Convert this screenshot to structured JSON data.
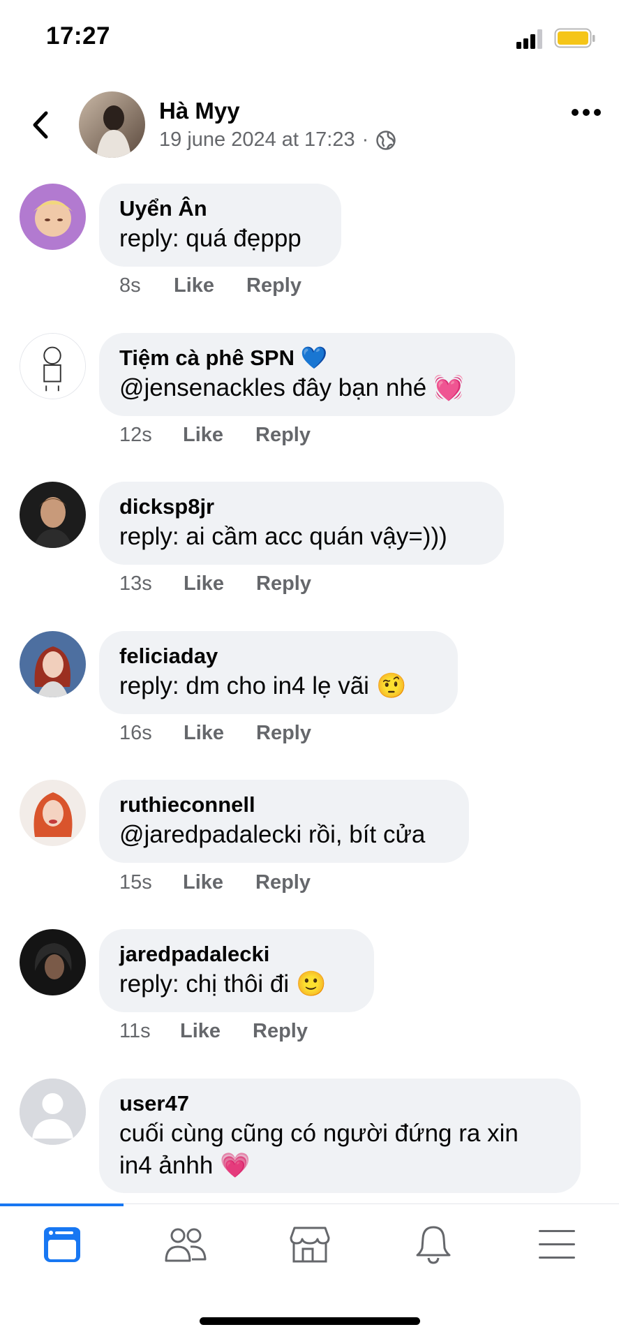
{
  "status_bar": {
    "time": "17:27"
  },
  "header": {
    "name": "Hà Myy",
    "timestamp": "19 june 2024 at 17:23",
    "separator": "·",
    "privacy_icon": "globe-icon"
  },
  "comments": [
    {
      "name": "Uyển Ân",
      "text": "reply: quá đẹppp",
      "time": "8s",
      "like": "Like",
      "reply": "Reply"
    },
    {
      "name": "Tiệm cà phê SPN",
      "name_emoji": "💙",
      "text": "@jensenackles đây bạn nhé",
      "text_emoji": "💓",
      "time": "12s",
      "like": "Like",
      "reply": "Reply"
    },
    {
      "name": "dicksp8jr",
      "text": "reply: ai cầm acc quán vậy=)))",
      "time": "13s",
      "like": "Like",
      "reply": "Reply"
    },
    {
      "name": "feliciaday",
      "text": "reply: dm cho in4 lẹ vãi",
      "text_emoji": "🤨",
      "time": "16s",
      "like": "Like",
      "reply": "Reply"
    },
    {
      "name": "ruthieconnell",
      "text": "@jaredpadalecki rồi, bít cửa",
      "time": "15s",
      "like": "Like",
      "reply": "Reply"
    },
    {
      "name": "jaredpadalecki",
      "text": "reply: chị thôi đi",
      "text_emoji": "🙂",
      "time": "11s",
      "like": "Like",
      "reply": "Reply"
    },
    {
      "name": "user47",
      "text_line1": "cuối cùng cũng có người đứng ra xin",
      "text_line2": "in4 ảnhh",
      "text_emoji": "💗"
    }
  ],
  "tabbar": {
    "tabs": [
      "feed-icon",
      "friends-icon",
      "marketplace-icon",
      "notifications-icon",
      "menu-icon"
    ],
    "accent_color": "#1877f2",
    "icon_color": "#65676b"
  }
}
